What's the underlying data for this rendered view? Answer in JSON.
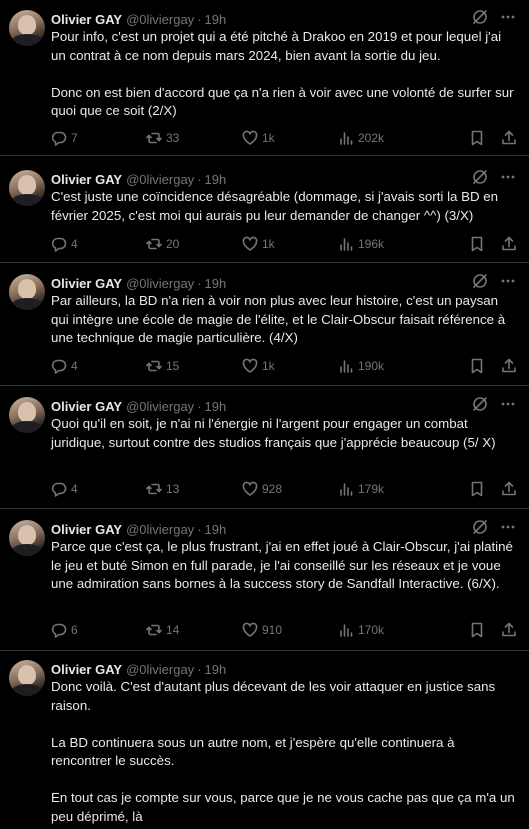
{
  "tweets": [
    {
      "name": "Olivier GAY",
      "handle": "@0livier­gay",
      "time": "19h",
      "paragraphs": [
        "Pour info, c'est un projet qui a été pitché à Drakoo en 2019 et pour lequel j'ai un contrat à ce nom depuis mars 2024, bien avant la sortie du jeu.",
        "Donc on est bien d'accord que ça n'a rien à voir avec une volonté de surfer sur quoi que ce soit (2/X)"
      ],
      "replies": "7",
      "retweets": "33",
      "likes": "1k",
      "views": "202k"
    },
    {
      "name": "Olivier GAY",
      "handle": "@0livier­gay",
      "time": "19h",
      "paragraphs": [
        "C'est juste une coïncidence désagréable (dommage, si j'avais sorti la BD en février 2025, c'est moi qui aurais pu leur demander de changer ^^) (3/X)"
      ],
      "replies": "4",
      "retweets": "20",
      "likes": "1k",
      "views": "196k"
    },
    {
      "name": "Olivier GAY",
      "handle": "@0livier­gay",
      "time": "19h",
      "paragraphs": [
        "Par ailleurs, la BD n'a rien à voir non plus avec leur histoire, c'est un paysan qui intègre une école de magie de l'élite, et le Clair-Obscur faisait référence à une technique de magie particulière. (4/X)"
      ],
      "replies": "4",
      "retweets": "15",
      "likes": "1k",
      "views": "190k"
    },
    {
      "name": "Olivier GAY",
      "handle": "@0livier­gay",
      "time": "19h",
      "paragraphs": [
        "Quoi qu'il en soit, je n'ai ni l'énergie ni l'argent pour engager un combat juridique, surtout contre des studios français que j'apprécie beaucoup (5/ X)"
      ],
      "replies": "4",
      "retweets": "13",
      "likes": "928",
      "views": "179k"
    },
    {
      "name": "Olivier GAY",
      "handle": "@0livier­gay",
      "time": "19h",
      "paragraphs": [
        "Parce que c'est ça, le plus frustrant, j'ai en effet joué à Clair-Obscur, j'ai platiné le jeu et buté Simon en full parade, je l'ai conseillé sur les réseaux et je voue une admiration sans bornes à la success story de Sandfall Interactive. (6/X)."
      ],
      "replies": "6",
      "retweets": "14",
      "likes": "910",
      "views": "170k"
    },
    {
      "name": "Olivier GAY",
      "handle": "@0livier­gay",
      "time": "19h",
      "paragraphs": [
        "Donc voilà. C'est d'autant plus décevant de les voir attaquer en justice sans raison.",
        "La BD continuera sous un autre nom, et j'espère qu'elle continuera à rencontrer le succès.",
        "En tout cas je compte sur vous, parce que je ne vous cache pas que ça m'a un peu déprimé, là"
      ]
    }
  ],
  "dot": "·"
}
